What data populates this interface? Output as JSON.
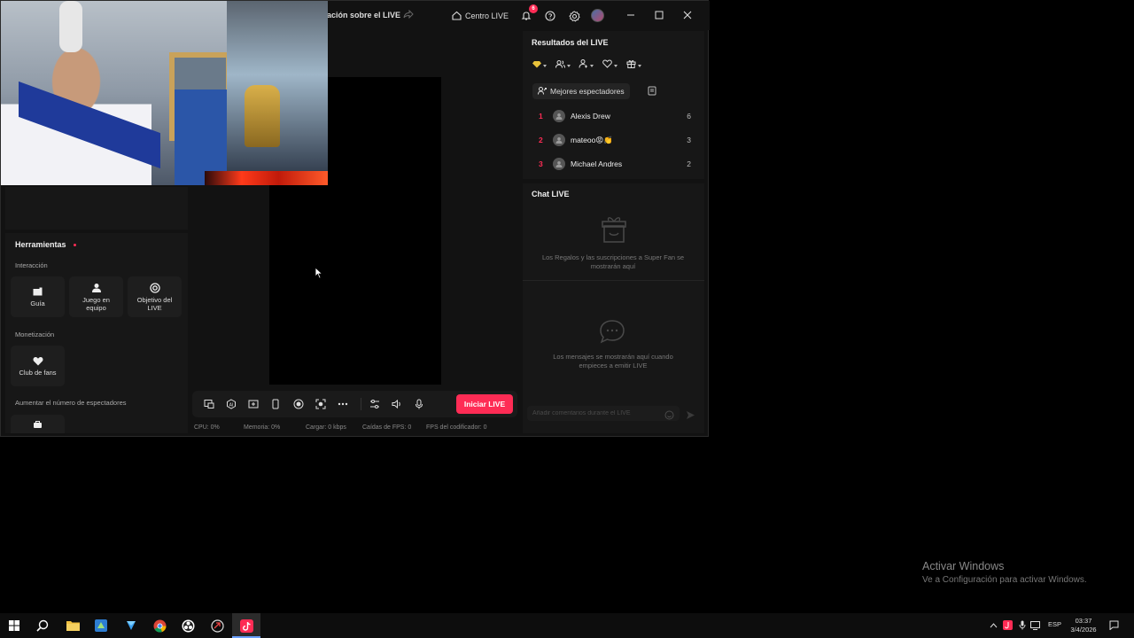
{
  "window": {
    "title_partial": "ación sobre el LIVE",
    "centro_live": "Centro LIVE",
    "notification_count": "6",
    "controls": [
      "minimize",
      "maximize",
      "close"
    ]
  },
  "tools": {
    "title": "Herramientas",
    "interaction_label": "Interacción",
    "interaction_items": [
      {
        "label": "Guía",
        "icon": "guide-icon"
      },
      {
        "label": "Juego en equipo",
        "icon": "team-game-icon"
      },
      {
        "label": "Objetivo del LIVE",
        "icon": "target-icon"
      }
    ],
    "monetization_label": "Monetización",
    "monetization_items": [
      {
        "label": "Club de fans",
        "icon": "heart-icon"
      }
    ],
    "audience_label": "Aumentar el número de espectadores"
  },
  "controlbar": {
    "icons": [
      "screen-share-icon",
      "effects-icon",
      "layout-icon",
      "mobile-icon",
      "record-icon",
      "camera-settings-icon",
      "more-icon",
      "adjust-icon",
      "volume-icon",
      "microphone-icon"
    ],
    "go_live_label": "Iniciar LIVE"
  },
  "stats": {
    "cpu": "CPU:  0%",
    "memory": "Memoria:  0%",
    "upload": "Cargar:  0 kbps",
    "fps_drops": "Caídas de FPS:  0",
    "encoder_fps": "FPS del codificador:  0"
  },
  "results": {
    "title": "Resultados del LIVE",
    "filters": [
      "diamond-icon",
      "viewers-icon",
      "followers-icon",
      "likes-icon",
      "gift-icon"
    ],
    "tab_label": "Mejores espectadores",
    "viewers": [
      {
        "rank": "1",
        "name": "Alexis Drew",
        "count": "6"
      },
      {
        "rank": "2",
        "name": "mateoo😡👏",
        "count": "3"
      },
      {
        "rank": "3",
        "name": "Michael Andres",
        "count": "2"
      }
    ]
  },
  "chat": {
    "title": "Chat LIVE",
    "gifts_empty": "Los Regalos y las suscripciones a Super Fan se mostrarán aquí",
    "messages_empty": "Los mensajes se mostrarán aquí cuando empieces a emitir LIVE",
    "input_placeholder": "Añadir comentarios durante el LIVE"
  },
  "watermark": {
    "line1": "Activar Windows",
    "line2": "Ve a Configuración para activar Windows."
  },
  "taskbar": {
    "apps": [
      "windows-start-icon",
      "search-icon",
      "file-explorer-icon",
      "app-icon",
      "app-icon-2",
      "chrome-icon",
      "obs-icon",
      "browser-icon",
      "tiktok-live-studio-icon"
    ],
    "language": "ESP",
    "time": "03:37",
    "date": "3/4/2026"
  },
  "colors": {
    "accent": "#fe2c55",
    "panel": "#171717",
    "background": "#121212"
  }
}
